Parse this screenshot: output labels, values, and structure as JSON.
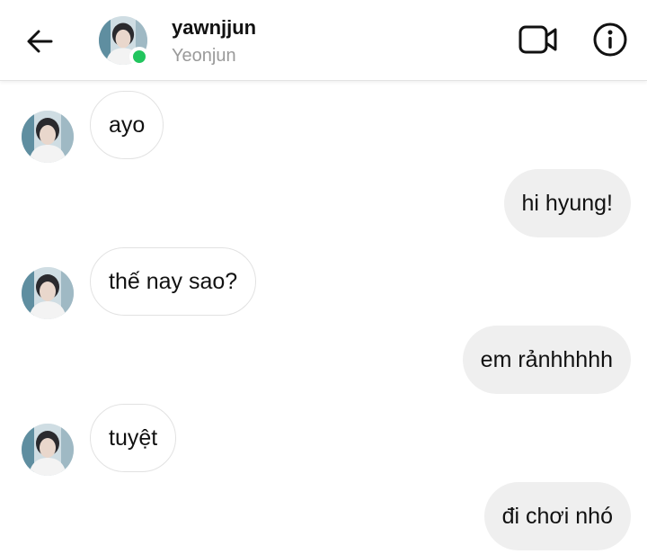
{
  "header": {
    "username": "yawnjjun",
    "display_name": "Yeonjun",
    "online": true,
    "icons": [
      "back-arrow-icon",
      "video-call-icon",
      "info-icon"
    ]
  },
  "messages": [
    {
      "direction": "in",
      "text": "ayo"
    },
    {
      "direction": "out",
      "text": "hi hyung!"
    },
    {
      "direction": "in",
      "text": "thế nay sao?"
    },
    {
      "direction": "out",
      "text": "em rảnhhhhh"
    },
    {
      "direction": "in",
      "text": "tuyệt"
    },
    {
      "direction": "out",
      "text": "đi chơi nhó"
    }
  ],
  "colors": {
    "online": "#22c55e",
    "outgoing_bubble": "#efefef",
    "incoming_bubble": "#ffffff"
  }
}
